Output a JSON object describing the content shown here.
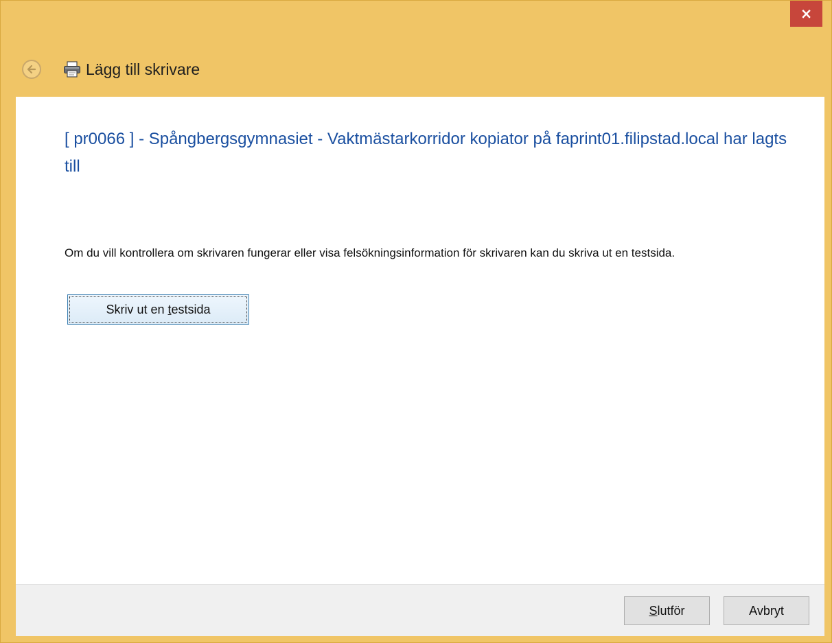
{
  "window": {
    "close_label": "×",
    "title": "Lägg till skrivare"
  },
  "icons": {
    "back": "back-arrow-icon",
    "printer": "printer-icon"
  },
  "content": {
    "heading": "[ pr0066 ] - Spångbergsgymnasiet - Vaktmästarkorridor kopiator på faprint01.filipstad.local har lagts till",
    "info": "Om du vill kontrollera om skrivaren fungerar eller visa felsökningsinformation för skrivaren kan du skriva ut en testsida.",
    "test_button": {
      "before": "Skriv ut en ",
      "underlined": "t",
      "after": "estsida"
    }
  },
  "footer": {
    "finish": {
      "underlined": "S",
      "after": "lutför"
    },
    "cancel": "Avbryt"
  },
  "colors": {
    "frame": "#f0c566",
    "close": "#c7463b",
    "heading": "#1a4fa0"
  }
}
